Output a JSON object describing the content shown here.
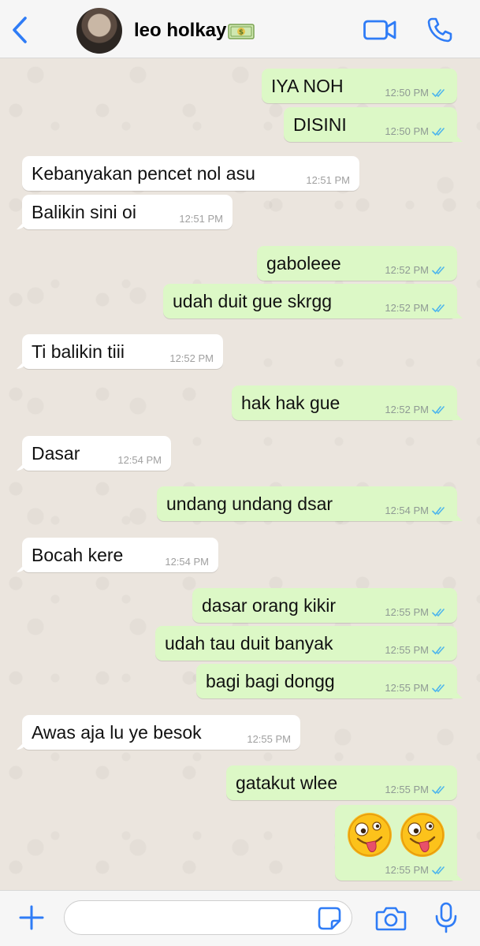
{
  "header": {
    "contact_name": "leo holkay",
    "name_emoji": "💵",
    "accent_color": "#2f7cf6"
  },
  "messages": [
    {
      "dir": "out",
      "text": "IYA NOH",
      "time": "12:50 PM"
    },
    {
      "dir": "out",
      "text": "DISINI",
      "time": "12:50 PM"
    },
    {
      "dir": "in",
      "text": "Kebanyakan pencet nol asu",
      "time": "12:51 PM"
    },
    {
      "dir": "in",
      "text": "Balikin sini oi",
      "time": "12:51 PM"
    },
    {
      "dir": "out",
      "text": "gaboleee",
      "time": "12:52 PM"
    },
    {
      "dir": "out",
      "text": "udah duit gue skrgg",
      "time": "12:52 PM"
    },
    {
      "dir": "in",
      "text": "Ti balikin tiii",
      "time": "12:52 PM"
    },
    {
      "dir": "out",
      "text": "hak hak gue",
      "time": "12:52 PM"
    },
    {
      "dir": "in",
      "text": "Dasar",
      "time": "12:54 PM"
    },
    {
      "dir": "out",
      "text": "undang undang dsar",
      "time": "12:54 PM"
    },
    {
      "dir": "in",
      "text": "Bocah kere",
      "time": "12:54 PM"
    },
    {
      "dir": "out",
      "text": "dasar orang kikir",
      "time": "12:55 PM"
    },
    {
      "dir": "out",
      "text": "udah tau duit banyak",
      "time": "12:55 PM"
    },
    {
      "dir": "out",
      "text": "bagi bagi dongg",
      "time": "12:55 PM"
    },
    {
      "dir": "in",
      "text": "Awas aja lu ye besok",
      "time": "12:55 PM"
    },
    {
      "dir": "out",
      "text": "gatakut wlee",
      "time": "12:55 PM"
    },
    {
      "dir": "out",
      "text": "🤪🤪",
      "time": "12:55 PM",
      "emoji_only": true
    }
  ],
  "input": {
    "placeholder": ""
  },
  "colors": {
    "outgoing_bubble": "#dcf8c6",
    "incoming_bubble": "#ffffff",
    "read_tick": "#4fb6ec"
  }
}
